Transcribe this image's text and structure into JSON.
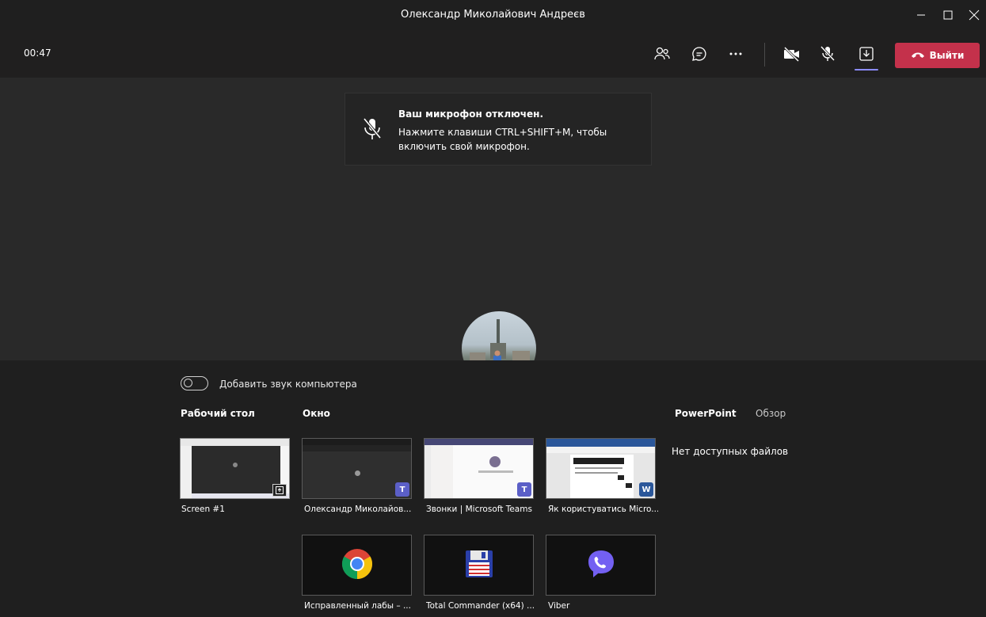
{
  "window": {
    "title": "Олександр Миколайович Андреєв",
    "minimize_icon": "minimize-icon",
    "maximize_icon": "maximize-icon",
    "close_icon": "close-icon"
  },
  "toolbar": {
    "timer": "00:47",
    "leave_label": "Выйти",
    "accent_leave": "#c4314b",
    "icons": [
      "participants-icon",
      "chat-icon",
      "more-icon",
      "camera-off-icon",
      "mic-off-icon",
      "share-tray-icon",
      "hangup-icon"
    ]
  },
  "notice": {
    "title": "Ваш микрофон отключен.",
    "line1": "Нажмите клавиши CTRL+SHIFT+M, чтобы",
    "line2": "включить свой микрофон."
  },
  "share": {
    "toggle_label": "Добавить звук компьютера",
    "sections": {
      "desktop": "Рабочий стол",
      "window": "Окно",
      "powerpoint": "PowerPoint",
      "browse": "Обзор"
    },
    "no_files": "Нет доступных файлов",
    "screens": [
      {
        "label": "Screen #1"
      }
    ],
    "windows": [
      {
        "label": "Олександр Миколайов..."
      },
      {
        "label": "Звонки | Microsoft Teams"
      },
      {
        "label": "Як користуватись Micro..."
      },
      {
        "label": "Исправленный лабы – ..."
      },
      {
        "label": "Total Commander (x64) ..."
      },
      {
        "label": "Viber"
      }
    ]
  }
}
